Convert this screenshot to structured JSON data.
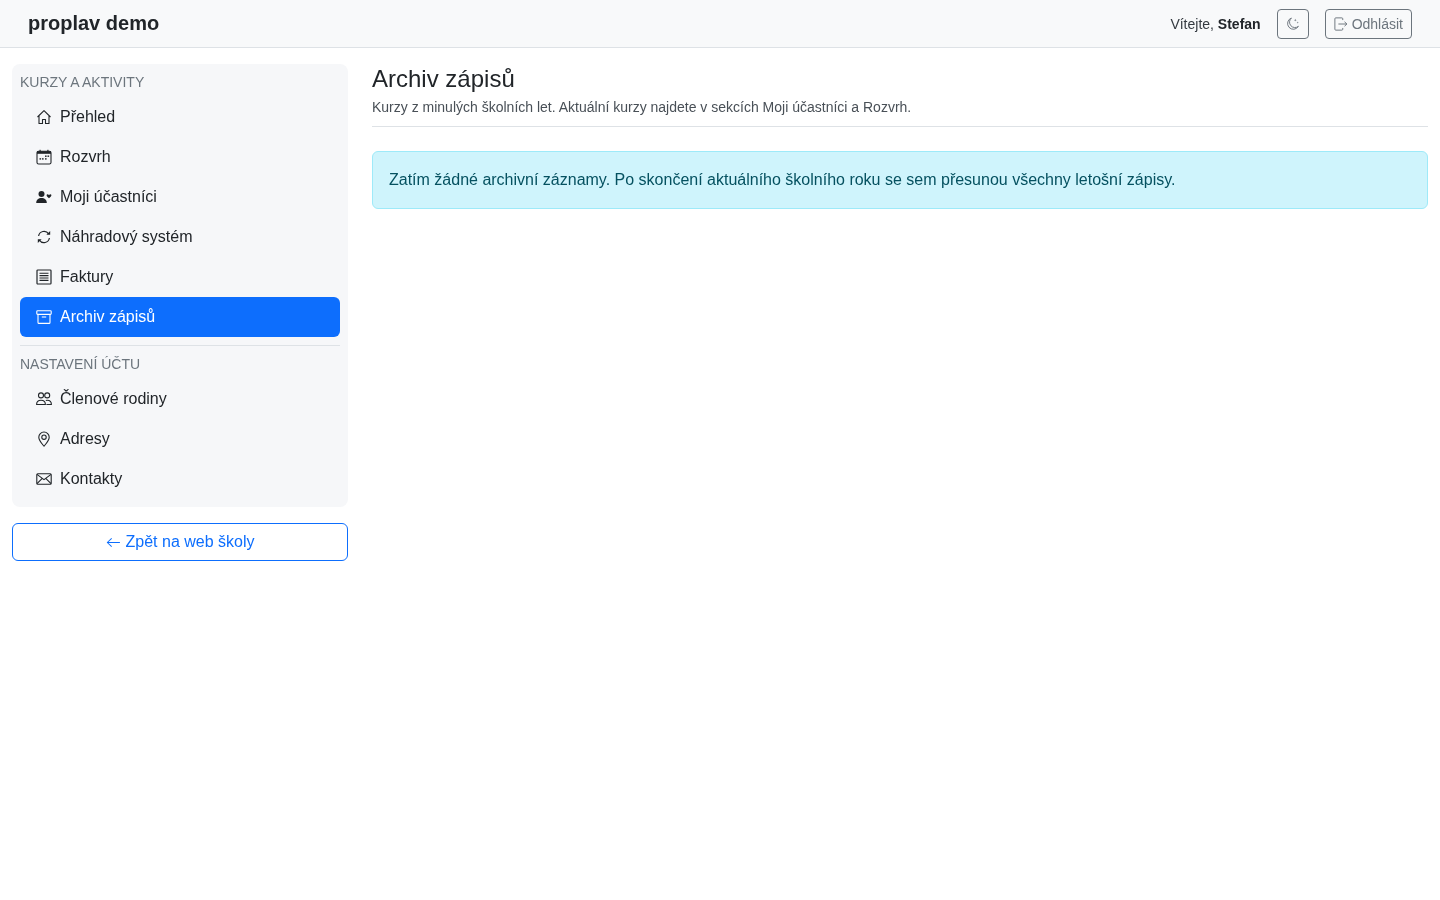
{
  "navbar": {
    "brand": "proplav demo",
    "greeting": "Vítejte, **Stefan**",
    "logout_button": "Odhlásit"
  },
  "sidebar": {
    "sections": [
      {
        "heading": "KURZY A AKTIVITY",
        "items": [
          {
            "label": "Přehled",
            "selected": false
          },
          {
            "label": "Rozvrh",
            "selected": false
          },
          {
            "label": "Moji účastníci",
            "selected": false
          },
          {
            "label": "Náhradový systém",
            "selected": false
          },
          {
            "label": "Faktury",
            "selected": false
          },
          {
            "label": "Archiv zápisů",
            "selected": true
          }
        ]
      },
      {
        "heading": "NASTAVENÍ ÚČTU",
        "items": [
          {
            "label": "Členové rodiny",
            "selected": false
          },
          {
            "label": "Adresy",
            "selected": false
          },
          {
            "label": "Kontakty",
            "selected": false
          }
        ]
      }
    ],
    "back_button": "Zpět na web školy"
  },
  "page": {
    "title": "Archiv zápisů",
    "subtitle": "Kurzy z minulých školních let. Aktuální kurzy najdete v sekcích Moji účastníci a Rozvrh.",
    "alert": "Zatím žádné archivní záznamy. Po skončení aktuálního školního roku se sem přesunou všechny letošní zápisy."
  }
}
